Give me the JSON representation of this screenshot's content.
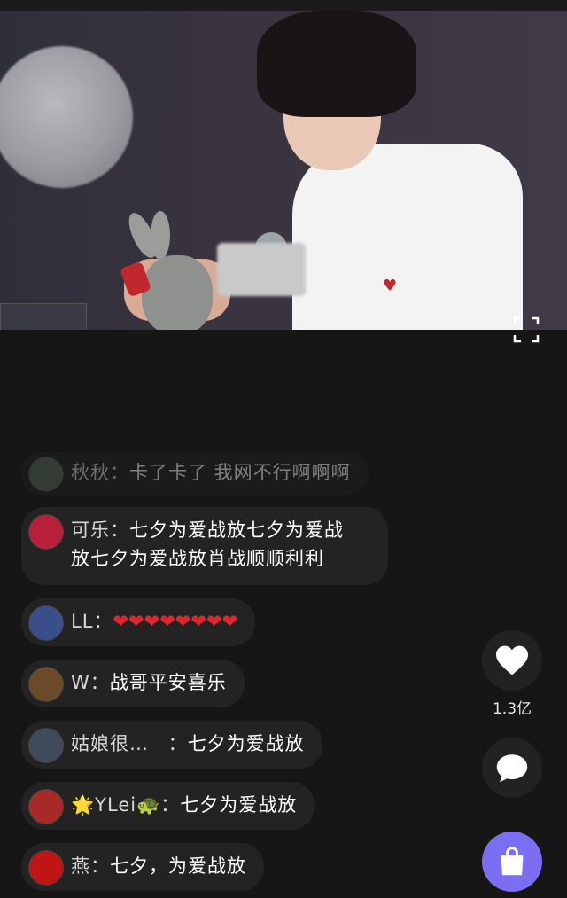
{
  "comments": [
    {
      "user": "秋秋",
      "sep": "：",
      "message": "卡了卡了 我网不行啊啊啊",
      "avatar_color": "#556b55"
    },
    {
      "user": "可乐",
      "sep": "：",
      "message_line1": "七夕为爱战放七夕为爱战",
      "message_line2": "放七夕为爱战放肖战顺顺利利",
      "avatar_color": "#b8203a"
    },
    {
      "user": "LL",
      "sep": "：",
      "message": "❤❤❤❤❤❤❤❤",
      "avatar_color": "#3a4f8a"
    },
    {
      "user": "W",
      "sep": "：",
      "message": "战哥平安喜乐",
      "avatar_color": "#6b4a2a"
    },
    {
      "user": "姑娘很…",
      "sep": " ：",
      "message": "七夕为爱战放",
      "avatar_color": "#3f4b5a"
    },
    {
      "user_prefix": "🌟",
      "user": "YLei",
      "user_suffix": "🐢",
      "sep": "：",
      "message": "七夕为爱战放",
      "avatar_color": "#a82a26"
    },
    {
      "user": "燕",
      "sep": "：",
      "message": "七夕，为爱战放",
      "avatar_color": "#c01515"
    }
  ],
  "actions": {
    "like_count": "1.3亿"
  },
  "colors": {
    "background": "#161616",
    "bubble": "#232323",
    "shop_accent": "#7b6ef2",
    "heart_red": "#e0262b"
  },
  "icons": [
    "fullscreen-icon",
    "heart-icon",
    "chat-bubble-icon",
    "shopping-bag-icon"
  ]
}
